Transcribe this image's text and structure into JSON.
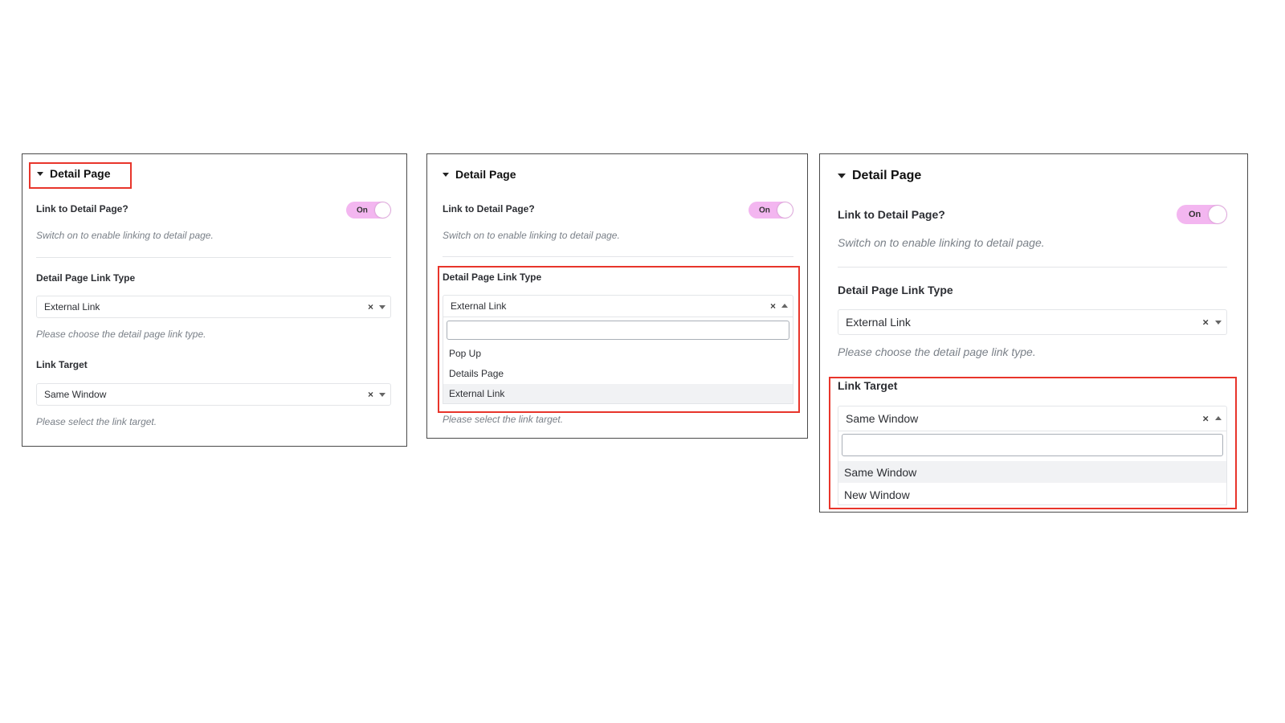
{
  "colors": {
    "accent_toggle": "#f3b6f0",
    "highlight_box": "#e8352b",
    "help_text": "#7a8088",
    "option_highlight": "#f1f2f4"
  },
  "icons": {
    "caret": "caret-down-icon",
    "clear": "clear-x-icon",
    "arrow_down": "chevron-down-icon",
    "arrow_up": "chevron-up-icon"
  },
  "panels": [
    {
      "section_title": "Detail Page",
      "link_label": "Link to Detail Page?",
      "toggle_text": "On",
      "link_help": "Switch on to enable linking to detail page.",
      "type_label": "Detail Page Link Type",
      "type_value": "External Link",
      "type_help": "Please choose the detail page link type.",
      "target_label": "Link Target",
      "target_value": "Same Window",
      "target_help": "Please select the link target.",
      "clear_symbol": "×"
    },
    {
      "section_title": "Detail Page",
      "link_label": "Link to Detail Page?",
      "toggle_text": "On",
      "link_help": "Switch on to enable linking to detail page.",
      "type_label": "Detail Page Link Type",
      "type_value": "External Link",
      "search_value": "",
      "options": [
        "Pop Up",
        "Details Page",
        "External Link"
      ],
      "highlighted_option": "External Link",
      "target_help": "Please select the link target.",
      "clear_symbol": "×"
    },
    {
      "section_title": "Detail Page",
      "link_label": "Link to Detail Page?",
      "toggle_text": "On",
      "link_help": "Switch on to enable linking to detail page.",
      "type_label": "Detail Page Link Type",
      "type_value": "External Link",
      "type_help": "Please choose the detail page link type.",
      "target_label": "Link Target",
      "target_value": "Same Window",
      "search_value": "",
      "options": [
        "Same Window",
        "New Window"
      ],
      "highlighted_option": "Same Window",
      "clear_symbol": "×"
    }
  ]
}
